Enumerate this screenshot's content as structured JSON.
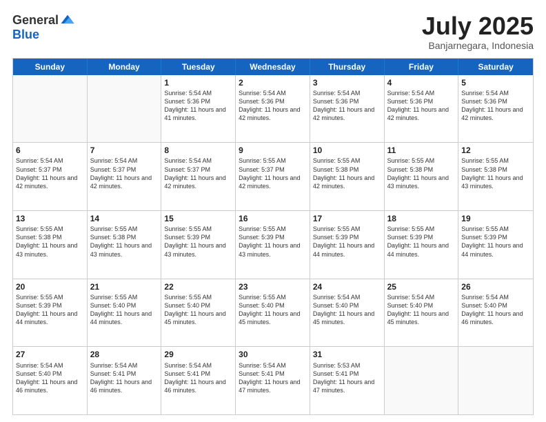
{
  "logo": {
    "general": "General",
    "blue": "Blue"
  },
  "title": "July 2025",
  "subtitle": "Banjarnegara, Indonesia",
  "days": [
    "Sunday",
    "Monday",
    "Tuesday",
    "Wednesday",
    "Thursday",
    "Friday",
    "Saturday"
  ],
  "weeks": [
    [
      {
        "day": "",
        "info": ""
      },
      {
        "day": "",
        "info": ""
      },
      {
        "day": "1",
        "info": "Sunrise: 5:54 AM\nSunset: 5:36 PM\nDaylight: 11 hours and 41 minutes."
      },
      {
        "day": "2",
        "info": "Sunrise: 5:54 AM\nSunset: 5:36 PM\nDaylight: 11 hours and 42 minutes."
      },
      {
        "day": "3",
        "info": "Sunrise: 5:54 AM\nSunset: 5:36 PM\nDaylight: 11 hours and 42 minutes."
      },
      {
        "day": "4",
        "info": "Sunrise: 5:54 AM\nSunset: 5:36 PM\nDaylight: 11 hours and 42 minutes."
      },
      {
        "day": "5",
        "info": "Sunrise: 5:54 AM\nSunset: 5:36 PM\nDaylight: 11 hours and 42 minutes."
      }
    ],
    [
      {
        "day": "6",
        "info": "Sunrise: 5:54 AM\nSunset: 5:37 PM\nDaylight: 11 hours and 42 minutes."
      },
      {
        "day": "7",
        "info": "Sunrise: 5:54 AM\nSunset: 5:37 PM\nDaylight: 11 hours and 42 minutes."
      },
      {
        "day": "8",
        "info": "Sunrise: 5:54 AM\nSunset: 5:37 PM\nDaylight: 11 hours and 42 minutes."
      },
      {
        "day": "9",
        "info": "Sunrise: 5:55 AM\nSunset: 5:37 PM\nDaylight: 11 hours and 42 minutes."
      },
      {
        "day": "10",
        "info": "Sunrise: 5:55 AM\nSunset: 5:38 PM\nDaylight: 11 hours and 42 minutes."
      },
      {
        "day": "11",
        "info": "Sunrise: 5:55 AM\nSunset: 5:38 PM\nDaylight: 11 hours and 43 minutes."
      },
      {
        "day": "12",
        "info": "Sunrise: 5:55 AM\nSunset: 5:38 PM\nDaylight: 11 hours and 43 minutes."
      }
    ],
    [
      {
        "day": "13",
        "info": "Sunrise: 5:55 AM\nSunset: 5:38 PM\nDaylight: 11 hours and 43 minutes."
      },
      {
        "day": "14",
        "info": "Sunrise: 5:55 AM\nSunset: 5:38 PM\nDaylight: 11 hours and 43 minutes."
      },
      {
        "day": "15",
        "info": "Sunrise: 5:55 AM\nSunset: 5:39 PM\nDaylight: 11 hours and 43 minutes."
      },
      {
        "day": "16",
        "info": "Sunrise: 5:55 AM\nSunset: 5:39 PM\nDaylight: 11 hours and 43 minutes."
      },
      {
        "day": "17",
        "info": "Sunrise: 5:55 AM\nSunset: 5:39 PM\nDaylight: 11 hours and 44 minutes."
      },
      {
        "day": "18",
        "info": "Sunrise: 5:55 AM\nSunset: 5:39 PM\nDaylight: 11 hours and 44 minutes."
      },
      {
        "day": "19",
        "info": "Sunrise: 5:55 AM\nSunset: 5:39 PM\nDaylight: 11 hours and 44 minutes."
      }
    ],
    [
      {
        "day": "20",
        "info": "Sunrise: 5:55 AM\nSunset: 5:39 PM\nDaylight: 11 hours and 44 minutes."
      },
      {
        "day": "21",
        "info": "Sunrise: 5:55 AM\nSunset: 5:40 PM\nDaylight: 11 hours and 44 minutes."
      },
      {
        "day": "22",
        "info": "Sunrise: 5:55 AM\nSunset: 5:40 PM\nDaylight: 11 hours and 45 minutes."
      },
      {
        "day": "23",
        "info": "Sunrise: 5:55 AM\nSunset: 5:40 PM\nDaylight: 11 hours and 45 minutes."
      },
      {
        "day": "24",
        "info": "Sunrise: 5:54 AM\nSunset: 5:40 PM\nDaylight: 11 hours and 45 minutes."
      },
      {
        "day": "25",
        "info": "Sunrise: 5:54 AM\nSunset: 5:40 PM\nDaylight: 11 hours and 45 minutes."
      },
      {
        "day": "26",
        "info": "Sunrise: 5:54 AM\nSunset: 5:40 PM\nDaylight: 11 hours and 46 minutes."
      }
    ],
    [
      {
        "day": "27",
        "info": "Sunrise: 5:54 AM\nSunset: 5:40 PM\nDaylight: 11 hours and 46 minutes."
      },
      {
        "day": "28",
        "info": "Sunrise: 5:54 AM\nSunset: 5:41 PM\nDaylight: 11 hours and 46 minutes."
      },
      {
        "day": "29",
        "info": "Sunrise: 5:54 AM\nSunset: 5:41 PM\nDaylight: 11 hours and 46 minutes."
      },
      {
        "day": "30",
        "info": "Sunrise: 5:54 AM\nSunset: 5:41 PM\nDaylight: 11 hours and 47 minutes."
      },
      {
        "day": "31",
        "info": "Sunrise: 5:53 AM\nSunset: 5:41 PM\nDaylight: 11 hours and 47 minutes."
      },
      {
        "day": "",
        "info": ""
      },
      {
        "day": "",
        "info": ""
      }
    ]
  ]
}
